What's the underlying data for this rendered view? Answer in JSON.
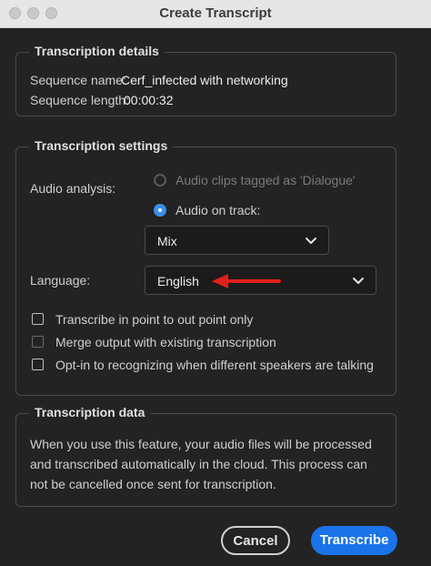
{
  "window": {
    "title": "Create Transcript"
  },
  "details": {
    "legend": "Transcription details",
    "sequence_name_label": "Sequence name:",
    "sequence_name_value": "Cerf_infected with networking",
    "sequence_length_label": "Sequence length:",
    "sequence_length_value": "00:00:32"
  },
  "settings": {
    "legend": "Transcription settings",
    "audio_analysis_label": "Audio analysis:",
    "radio_dialogue_label": "Audio clips tagged as 'Dialogue'",
    "radio_track_label": "Audio on track:",
    "track_select_value": "Mix",
    "language_label": "Language:",
    "language_select_value": "English",
    "checkbox_inout_label": "Transcribe in point to out point only",
    "checkbox_merge_label": "Merge output with existing transcription",
    "checkbox_speakers_label": "Opt-in to recognizing when different speakers are talking"
  },
  "data_section": {
    "legend": "Transcription data",
    "text": "When you use this feature, your audio files will be processed and transcribed automatically in the cloud. This process can not be cancelled once sent for transcription."
  },
  "buttons": {
    "cancel": "Cancel",
    "transcribe": "Transcribe"
  },
  "colors": {
    "accent": "#1a73e8",
    "annotation_arrow": "#e0201c"
  },
  "icons": [
    "chevron-down-icon",
    "red-arrow-annotation"
  ]
}
